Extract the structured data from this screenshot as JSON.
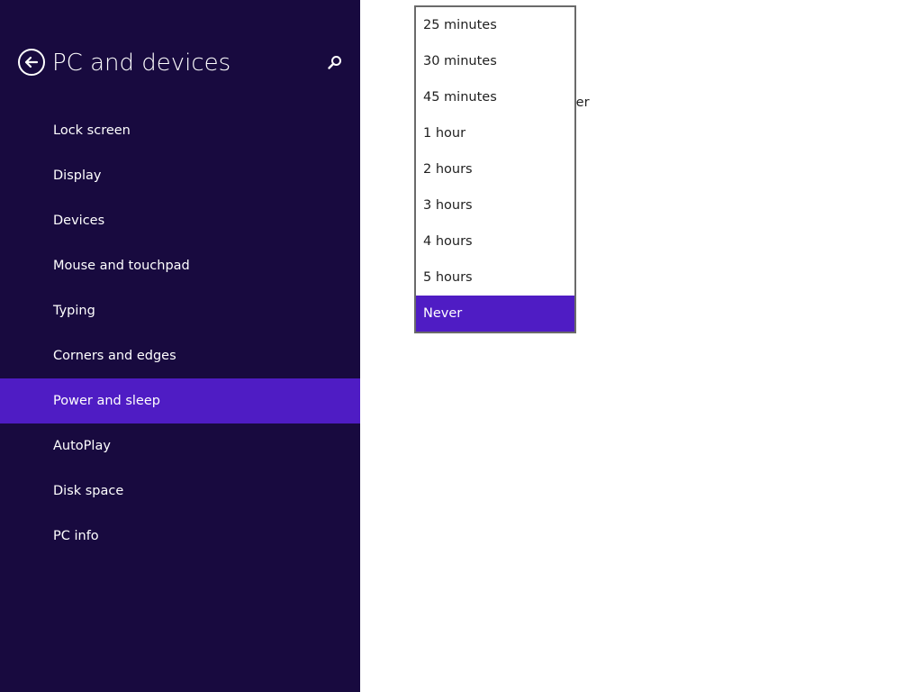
{
  "header": {
    "title": "PC and devices",
    "back_icon": "back-arrow-icon",
    "search_icon": "search-icon"
  },
  "sidebar": {
    "items": [
      {
        "label": "Lock screen"
      },
      {
        "label": "Display"
      },
      {
        "label": "Devices"
      },
      {
        "label": "Mouse and touchpad"
      },
      {
        "label": "Typing"
      },
      {
        "label": "Corners and edges"
      },
      {
        "label": "Power and sleep",
        "selected": true
      },
      {
        "label": "AutoPlay"
      },
      {
        "label": "Disk space"
      },
      {
        "label": "PC info"
      }
    ]
  },
  "content": {
    "partial_label": "ter"
  },
  "dropdown": {
    "options": [
      {
        "label": "25 minutes"
      },
      {
        "label": "30 minutes"
      },
      {
        "label": "45 minutes"
      },
      {
        "label": "1 hour"
      },
      {
        "label": "2 hours"
      },
      {
        "label": "3 hours"
      },
      {
        "label": "4 hours"
      },
      {
        "label": "5 hours"
      },
      {
        "label": "Never",
        "selected": true
      }
    ]
  },
  "colors": {
    "sidebar_background": "#180a3f",
    "accent": "#4f1cc4",
    "content_background": "#ffffff",
    "dropdown_border": "#6a6a6a"
  }
}
